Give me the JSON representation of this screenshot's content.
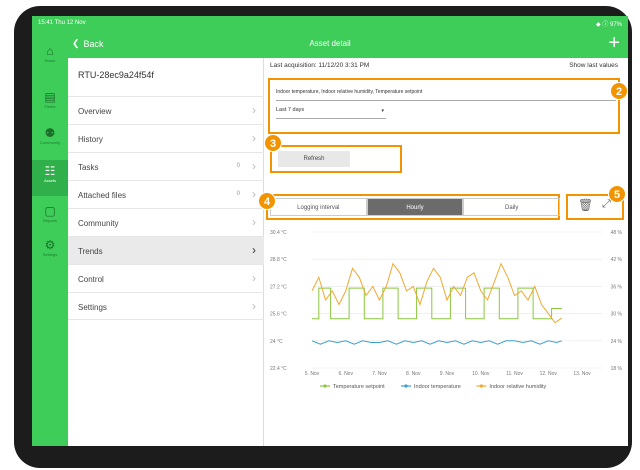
{
  "status": {
    "time": "15:41  Thu 12 Nov",
    "battery": "◆ ⓘ 97%"
  },
  "nav": {
    "back": "Back",
    "title": "Asset detail",
    "plus": "+"
  },
  "sidebar": [
    {
      "label": "Home",
      "icon": "home-icon",
      "glyph": "⌂"
    },
    {
      "label": "Fleets",
      "icon": "fleets-icon",
      "glyph": "▤"
    },
    {
      "label": "Community",
      "icon": "community-icon",
      "glyph": "⚉"
    },
    {
      "label": "Assets",
      "icon": "assets-icon",
      "glyph": "☷"
    },
    {
      "label": "Reports",
      "icon": "reports-icon",
      "glyph": "▢"
    },
    {
      "label": "Settings",
      "icon": "settings-icon",
      "glyph": "⚙"
    }
  ],
  "asset_name": "RTU-28ec9a24f54f",
  "menu": [
    {
      "label": "Overview",
      "count": ""
    },
    {
      "label": "History",
      "count": ""
    },
    {
      "label": "Tasks",
      "count": "0"
    },
    {
      "label": "Attached files",
      "count": "0"
    },
    {
      "label": "Community",
      "count": ""
    },
    {
      "label": "Trends",
      "count": ""
    },
    {
      "label": "Control",
      "count": ""
    },
    {
      "label": "Settings",
      "count": ""
    }
  ],
  "content": {
    "last_acquisition": "Last acquisition:  11/12/20 3:31 PM",
    "show_last_values": "Show last values",
    "series_select": "Indoor temperature, Indoor relative humidity, Temperature setpoint",
    "range_select": "Last 7 days",
    "refresh": "Refresh",
    "segments": [
      "Logging interval",
      "Hourly",
      "Daily"
    ],
    "badges": [
      "2",
      "3",
      "4",
      "5"
    ]
  },
  "chart_data": {
    "type": "line",
    "x_labels": [
      "5. Nov",
      "6. Nov",
      "7. Nov",
      "8. Nov",
      "9. Nov",
      "10. Nov",
      "11. Nov",
      "12. Nov",
      "13. Nov"
    ],
    "y_left_labels": [
      "30.4 °C",
      "28.8 °C",
      "27.2 °C",
      "25.6 °C",
      "24 °C",
      "22.4 °C"
    ],
    "y_left": [
      30.4,
      28.8,
      27.2,
      25.6,
      24,
      22.4
    ],
    "y_right_labels": [
      "48 %",
      "42 %",
      "36 %",
      "30 %",
      "24 %",
      "18 %"
    ],
    "y_right": [
      48,
      42,
      36,
      30,
      24,
      18
    ],
    "colors": {
      "setpoint": "#8cc63f",
      "indoor": "#3aa0d0",
      "humidity": "#f0a830"
    },
    "series": [
      {
        "name": "Temperature setpoint",
        "axis": "left",
        "x": [
          5.0,
          5.2,
          5.2,
          5.55,
          5.55,
          6.1,
          6.1,
          6.55,
          6.55,
          7.1,
          7.1,
          7.55,
          7.55,
          8.1,
          8.1,
          8.55,
          8.55,
          9.1,
          9.1,
          9.55,
          9.55,
          10.1,
          10.1,
          10.55,
          10.55,
          11.1,
          11.1,
          11.55,
          11.55,
          12.1,
          12.1,
          12.4
        ],
        "y": [
          25.3,
          25.3,
          27.1,
          27.1,
          25.3,
          25.3,
          27.1,
          27.1,
          25.3,
          25.3,
          27.1,
          27.1,
          25.3,
          25.3,
          27.1,
          27.1,
          25.3,
          25.3,
          27.1,
          27.1,
          25.3,
          25.3,
          27.1,
          27.1,
          25.3,
          25.3,
          27.1,
          27.1,
          25.3,
          25.3,
          25.9,
          25.9
        ]
      },
      {
        "name": "Indoor temperature",
        "axis": "left",
        "x": [
          5.0,
          5.25,
          5.5,
          5.75,
          6.0,
          6.25,
          6.5,
          6.75,
          7.0,
          7.25,
          7.5,
          7.75,
          8.0,
          8.25,
          8.5,
          8.75,
          9.0,
          9.25,
          9.5,
          9.75,
          10.0,
          10.25,
          10.5,
          10.75,
          11.0,
          11.25,
          11.5,
          11.75,
          12.0,
          12.25,
          12.4
        ],
        "y": [
          24.0,
          23.8,
          24.0,
          23.9,
          24.0,
          23.8,
          24.0,
          23.9,
          23.9,
          24.0,
          23.8,
          24.0,
          23.9,
          24.0,
          23.8,
          24.0,
          23.9,
          24.0,
          23.8,
          24.0,
          23.9,
          24.0,
          23.8,
          24.0,
          24.0,
          23.9,
          24.0,
          23.8,
          24.0,
          23.9,
          24.0
        ]
      },
      {
        "name": "Indoor relative humidity",
        "axis": "right",
        "x": [
          5.0,
          5.2,
          5.4,
          5.6,
          5.8,
          6.0,
          6.2,
          6.4,
          6.6,
          6.8,
          7.0,
          7.2,
          7.4,
          7.6,
          7.8,
          8.0,
          8.2,
          8.4,
          8.6,
          8.8,
          9.0,
          9.2,
          9.4,
          9.6,
          9.8,
          10.0,
          10.2,
          10.4,
          10.6,
          10.8,
          11.0,
          11.2,
          11.4,
          11.6,
          11.8,
          12.0,
          12.2,
          12.4
        ],
        "y": [
          35,
          38,
          33,
          35,
          32,
          35,
          40,
          38,
          34,
          36,
          33,
          36,
          41,
          39,
          35,
          36,
          32,
          37,
          40,
          38,
          33,
          36,
          34,
          38,
          39,
          35,
          33,
          37,
          41,
          38,
          34,
          35,
          33,
          36,
          32,
          30,
          28,
          29
        ]
      }
    ]
  }
}
